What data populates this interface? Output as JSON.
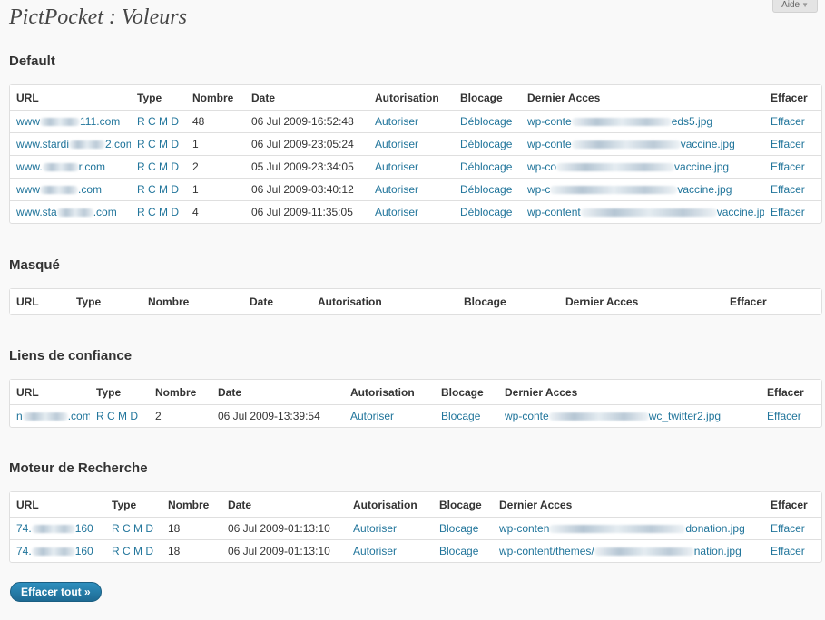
{
  "help": {
    "label": "Aide"
  },
  "page": {
    "title": "PictPocket : Voleurs"
  },
  "sections": {
    "default": {
      "title": "Default",
      "headers": [
        "URL",
        "Type",
        "Nombre",
        "Date",
        "Autorisation",
        "Blocage",
        "Dernier Acces",
        "Effacer"
      ],
      "rows": [
        {
          "url_a": "www",
          "url_b": "111.com",
          "count": "48",
          "date": "06 Jul 2009-16:52:48",
          "auth": "Autoriser",
          "block": "Déblocage",
          "last_a": "wp-conte",
          "last_b": "eds5.jpg",
          "del": "Effacer"
        },
        {
          "url_a": "www.stardi",
          "url_b": "2.com",
          "count": "1",
          "date": "06 Jul 2009-23:05:24",
          "auth": "Autoriser",
          "block": "Déblocage",
          "last_a": "wp-conte",
          "last_b": "vaccine.jpg",
          "del": "Effacer"
        },
        {
          "url_a": "www.",
          "url_b": "r.com",
          "count": "2",
          "date": "05 Jul 2009-23:34:05",
          "auth": "Autoriser",
          "block": "Déblocage",
          "last_a": "wp-co",
          "last_b": "vaccine.jpg",
          "del": "Effacer"
        },
        {
          "url_a": "www",
          "url_b": ".com",
          "count": "1",
          "date": "06 Jul 2009-03:40:12",
          "auth": "Autoriser",
          "block": "Déblocage",
          "last_a": "wp-c",
          "last_b": "vaccine.jpg",
          "del": "Effacer"
        },
        {
          "url_a": "www.sta",
          "url_b": ".com",
          "count": "4",
          "date": "06 Jul 2009-11:35:05",
          "auth": "Autoriser",
          "block": "Déblocage",
          "last_a": "wp-content",
          "last_b": "vaccine.jpg",
          "del": "Effacer"
        }
      ],
      "type_links": [
        "R",
        "C",
        "M",
        "D"
      ]
    },
    "masque": {
      "title": "Masqué",
      "headers": [
        "URL",
        "Type",
        "Nombre",
        "Date",
        "Autorisation",
        "Blocage",
        "Dernier Acces",
        "Effacer"
      ]
    },
    "trusted": {
      "title": "Liens de confiance",
      "headers": [
        "URL",
        "Type",
        "Nombre",
        "Date",
        "Autorisation",
        "Blocage",
        "Dernier Acces",
        "Effacer"
      ],
      "rows": [
        {
          "url_a": "n",
          "url_b": ".com",
          "count": "2",
          "date": "06 Jul 2009-13:39:54",
          "auth": "Autoriser",
          "block": "Blocage",
          "last_a": "wp-conte",
          "last_b": "wc_twitter2.jpg",
          "del": "Effacer"
        }
      ]
    },
    "search": {
      "title": "Moteur de Recherche",
      "headers": [
        "URL",
        "Type",
        "Nombre",
        "Date",
        "Autorisation",
        "Blocage",
        "Dernier Acces",
        "Effacer"
      ],
      "rows": [
        {
          "url_a": "74.",
          "url_b": "160",
          "count": "18",
          "date": "06 Jul 2009-01:13:10",
          "auth": "Autoriser",
          "block": "Blocage",
          "last_a": "wp-conten",
          "last_b": "donation.jpg",
          "del": "Effacer"
        },
        {
          "url_a": "74.",
          "url_b": "160",
          "count": "18",
          "date": "06 Jul 2009-01:13:10",
          "auth": "Autoriser",
          "block": "Blocage",
          "last_a": "wp-content/themes/",
          "last_b": "nation.jpg",
          "del": "Effacer"
        }
      ]
    }
  },
  "actions": {
    "clear_all": "Effacer tout »"
  }
}
